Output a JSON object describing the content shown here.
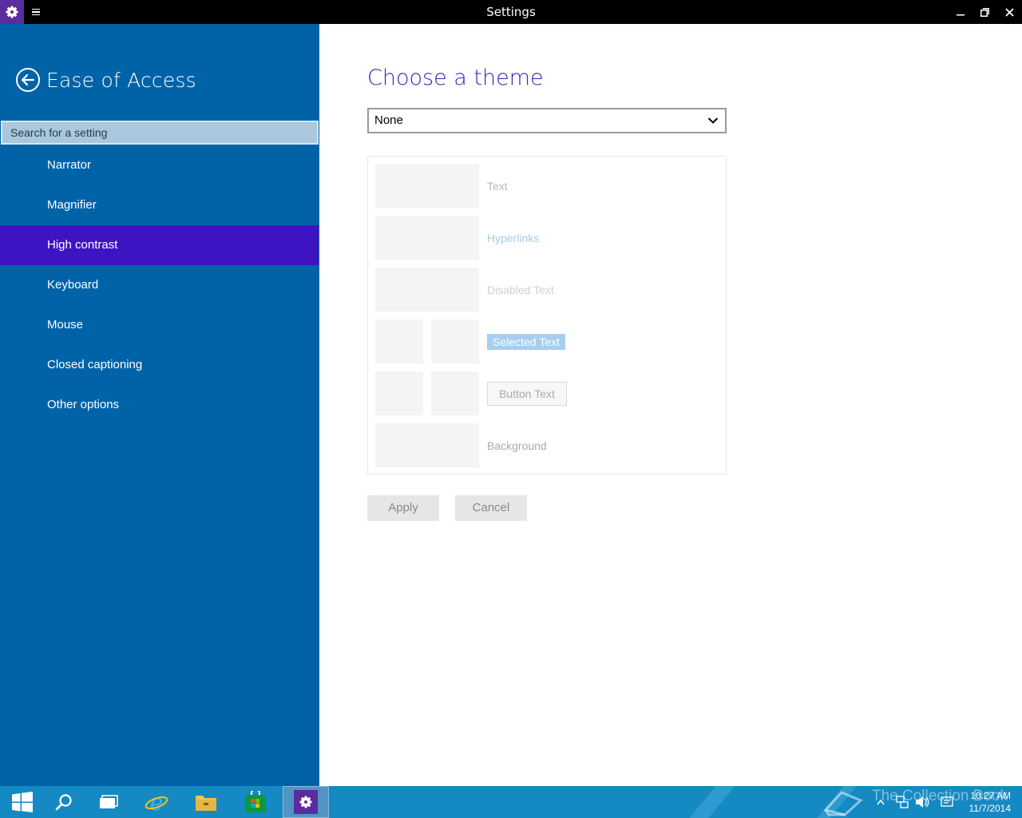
{
  "window": {
    "title": "Settings",
    "accent": "#5b2c9e"
  },
  "sidebar": {
    "title": "Ease of Access",
    "search_placeholder": "Search for a setting",
    "bg_color": "#0063a8",
    "active_color": "#3e14c2",
    "items": [
      {
        "label": "Narrator"
      },
      {
        "label": "Magnifier"
      },
      {
        "label": "High contrast",
        "active": true
      },
      {
        "label": "Keyboard"
      },
      {
        "label": "Mouse"
      },
      {
        "label": "Closed captioning"
      },
      {
        "label": "Other options"
      }
    ]
  },
  "main": {
    "heading": "Choose a theme",
    "theme_select": {
      "value": "None"
    },
    "preview": {
      "text": "Text",
      "hyperlinks": "Hyperlinks",
      "disabled_text": "Disabled Text",
      "selected_text": "Selected Text",
      "button_text": "Button Text",
      "background": "Background"
    },
    "apply_label": "Apply",
    "cancel_label": "Cancel"
  },
  "taskbar": {
    "time": "10:27 AM",
    "date": "11/7/2014",
    "watermark": "The Collection Book",
    "apps": [
      "start-icon",
      "search-icon",
      "task-view-icon",
      "internet-explorer-icon",
      "file-explorer-icon",
      "store-icon",
      "settings-icon"
    ]
  }
}
